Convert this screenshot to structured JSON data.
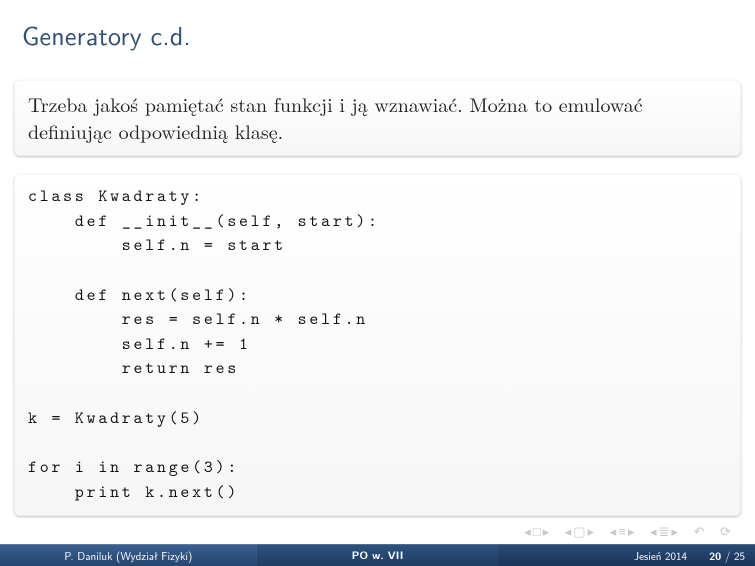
{
  "title": "Generatory c.d.",
  "intro": "Trzeba jakoś pamiętać stan funkcji i ją wznawiać. Można to emulować definiując odpowiednią klasę.",
  "code_lines": [
    {
      "t": "class ",
      "b": true,
      "rest": "Kwadraty:"
    },
    {
      "t": "    def ",
      "b": true,
      "rest": "__init__(self, start):"
    },
    {
      "t": "        ",
      "b": false,
      "rest": "self.n = start"
    },
    {
      "t": "",
      "b": false,
      "rest": ""
    },
    {
      "t": "    def ",
      "b": true,
      "rest": "next(self):"
    },
    {
      "t": "        ",
      "b": false,
      "rest": "res = self.n * self.n"
    },
    {
      "t": "        ",
      "b": false,
      "rest": "self.n += 1"
    },
    {
      "t": "        return ",
      "b": true,
      "rest": "res"
    },
    {
      "t": "",
      "b": false,
      "rest": ""
    },
    {
      "t": "",
      "b": false,
      "rest": "k = Kwadraty(5)"
    },
    {
      "t": "",
      "b": false,
      "rest": ""
    },
    {
      "t": "for ",
      "b": true,
      "mid": "i ",
      "mid2b": "in ",
      "rest": "range(3):"
    },
    {
      "t": "    print ",
      "b": true,
      "rest": "k.next()"
    }
  ],
  "nav": {
    "back_slide": "◂□▸",
    "back_sub": "◂▢▸",
    "fwd_sub": "◂≡▸",
    "fwd_slide": "◂≣▸",
    "pause": "↶",
    "refresh": "⟳"
  },
  "footer": {
    "author": "P. Daniluk (Wydział Fizyki)",
    "short_title": "PO w. VII",
    "date": "Jesień 2014",
    "page_current": "20",
    "page_sep": " / ",
    "page_total": "25"
  }
}
